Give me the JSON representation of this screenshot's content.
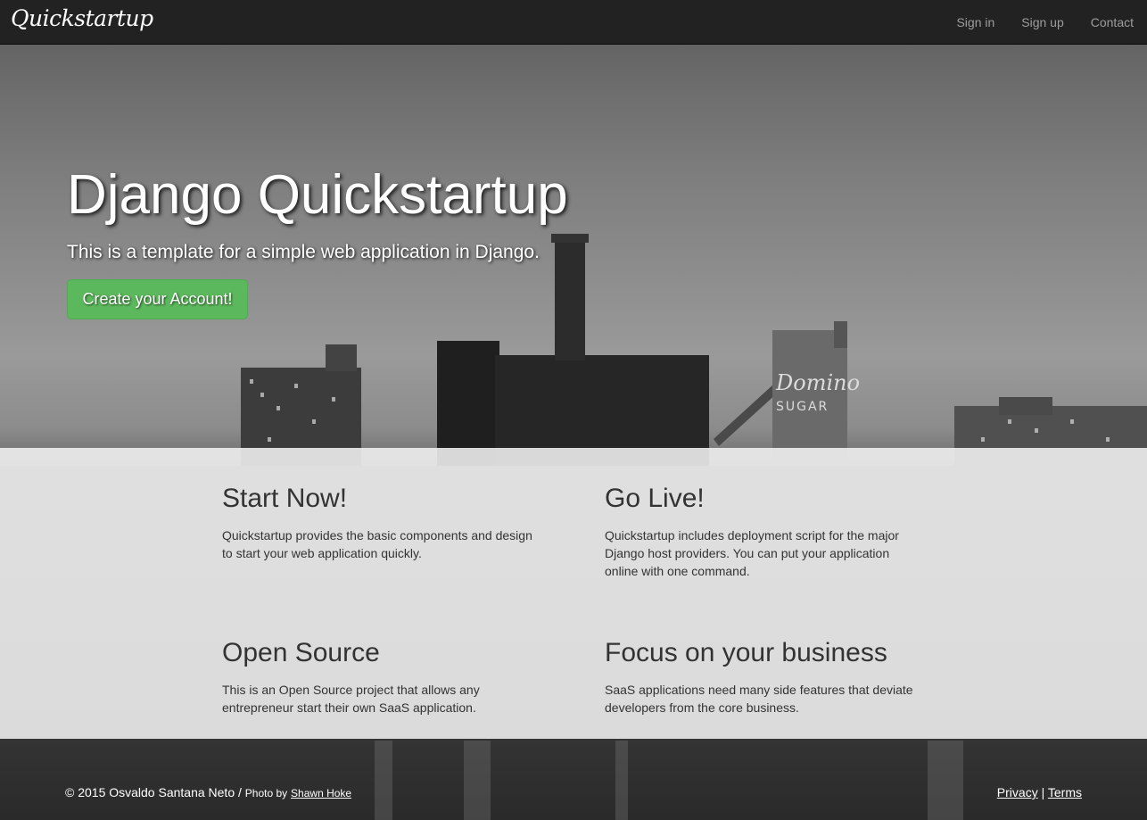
{
  "navbar": {
    "brand": "Quickstartup",
    "links": [
      "Sign in",
      "Sign up",
      "Contact"
    ]
  },
  "hero": {
    "title": "Django Quickstartup",
    "lead": "This is a template for a simple web application in Django.",
    "cta_label": "Create your Account!"
  },
  "features": [
    {
      "title": "Start Now!",
      "text": "Quickstartup provides the basic components and design to start your web application quickly."
    },
    {
      "title": "Go Live!",
      "text": "Quickstartup includes deployment script for the major Django host providers. You can put your application online with one command."
    },
    {
      "title": "Open Source",
      "text": "This is an Open Source project that allows any entrepreneur start their own SaaS application."
    },
    {
      "title": "Focus on your business",
      "text": "SaaS applications need many side features that deviate developers from the core business."
    }
  ],
  "footer": {
    "copyright": "© 2015 Osvaldo Santana Neto /",
    "photo_by": "Photo by",
    "photographer": "Shawn Hoke",
    "privacy": "Privacy",
    "separator": "|",
    "terms": "Terms"
  },
  "photo_sign_text": [
    "Domino",
    "SUGAR"
  ],
  "colors": {
    "navbar_bg": "#222222",
    "nav_link": "#9d9d9d",
    "cta_green": "#5cb85c",
    "panel_bg": "#f3f3f3"
  }
}
